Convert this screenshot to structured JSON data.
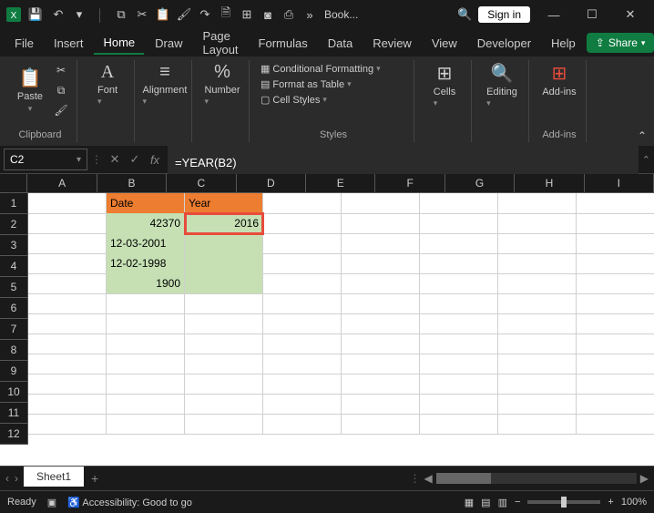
{
  "title_bar": {
    "filename": "Book...",
    "signin": "Sign in"
  },
  "menu_tabs": [
    "File",
    "Insert",
    "Home",
    "Draw",
    "Page Layout",
    "Formulas",
    "Data",
    "Review",
    "View",
    "Developer",
    "Help"
  ],
  "share": "Share",
  "ribbon": {
    "clipboard": {
      "paste": "Paste",
      "label": "Clipboard"
    },
    "font": {
      "btn": "Font"
    },
    "alignment": {
      "btn": "Alignment"
    },
    "number": {
      "btn": "Number"
    },
    "styles": {
      "cond": "Conditional Formatting",
      "table": "Format as Table",
      "cell": "Cell Styles",
      "label": "Styles"
    },
    "cells": {
      "btn": "Cells"
    },
    "editing": {
      "btn": "Editing"
    },
    "addins": {
      "btn": "Add-ins",
      "label": "Add-ins"
    }
  },
  "name_box": "C2",
  "formula": "=YEAR(B2)",
  "sheet": {
    "columns": [
      "A",
      "B",
      "C",
      "D",
      "E",
      "F",
      "G",
      "H",
      "I"
    ],
    "headers": {
      "b1": "Date",
      "c1": "Year"
    },
    "data": {
      "b2": "42370",
      "c2": "2016",
      "b3": "12-03-2001",
      "b4": "12-02-1998",
      "b5": "1900"
    },
    "tab": "Sheet1"
  },
  "status": {
    "ready": "Ready",
    "acc": "Accessibility: Good to go",
    "zoom": "100%"
  }
}
